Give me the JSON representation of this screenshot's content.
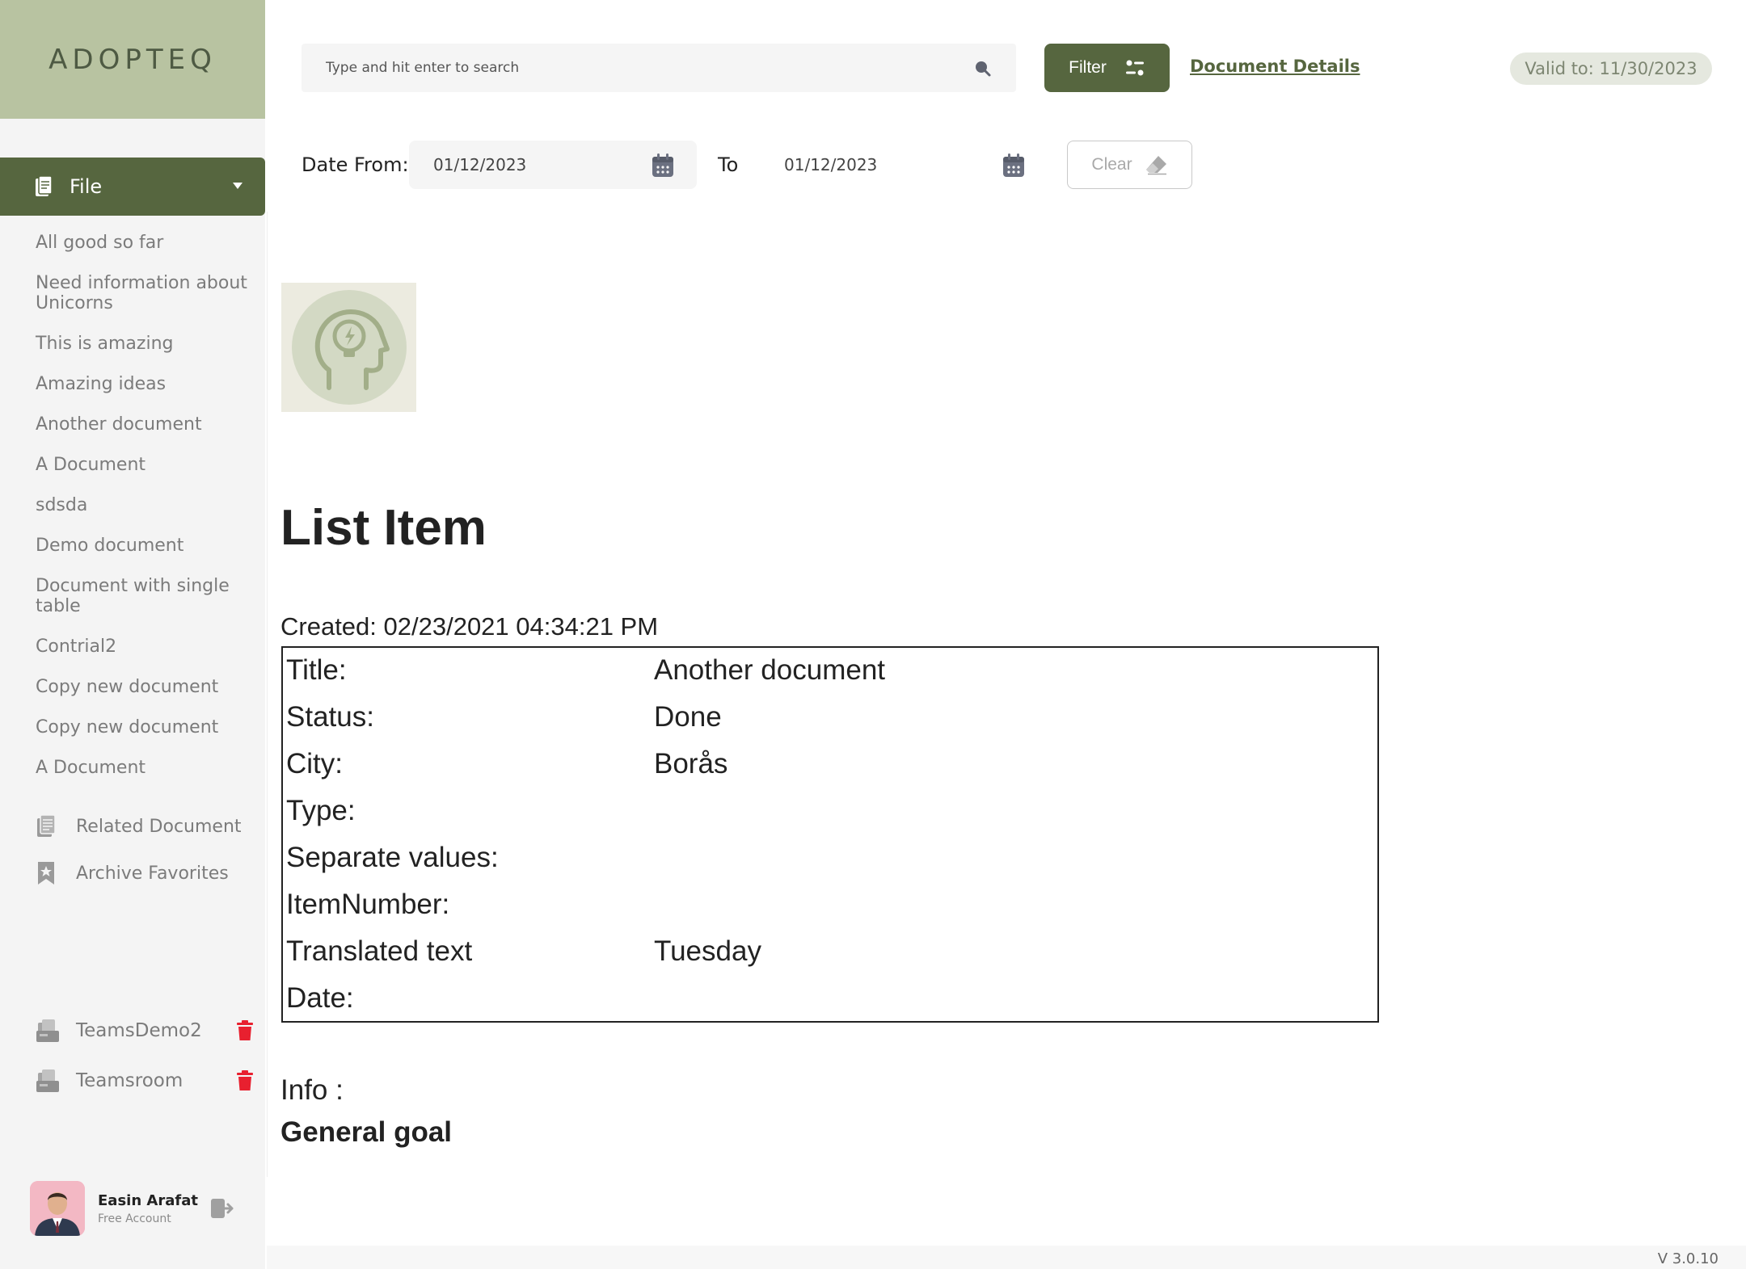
{
  "brand": {
    "logo_text": "ADOPTEQ"
  },
  "sidebar": {
    "file_tab_label": "File",
    "documents": [
      "All good so far",
      "Need information about Unicorns",
      "This is amazing",
      "Amazing ideas",
      "Another document",
      "A Document",
      "sdsda",
      "Demo document",
      "Document with single table",
      "Contrial2",
      "Copy new document",
      "Copy new document",
      "A Document"
    ],
    "related_document": "Related Document",
    "archive_favorites": "Archive Favorites",
    "teams": [
      "TeamsDemo2",
      "Teamsroom"
    ]
  },
  "user": {
    "name": "Easin Arafat",
    "plan": "Free Account"
  },
  "topbar": {
    "search_placeholder": "Type and hit enter to search",
    "filter_label": "Filter",
    "document_details_link": "Document Details",
    "valid_to": "Valid to: 11/30/2023"
  },
  "date_filter": {
    "from_label": "Date From:",
    "from_value": "01/12/2023",
    "to_label": "To",
    "to_value": "01/12/2023",
    "clear_label": "Clear"
  },
  "document": {
    "title": "List Item",
    "created": "Created: 02/23/2021 04:34:21 PM",
    "properties": [
      {
        "key": "Title:",
        "value": "Another document"
      },
      {
        "key": "Status:",
        "value": "Done"
      },
      {
        "key": "City:",
        "value": "Borås"
      },
      {
        "key": "Type:",
        "value": ""
      },
      {
        "key": "Separate values:",
        "value": ""
      },
      {
        "key": "ItemNumber:",
        "value": ""
      },
      {
        "key": "Translated text",
        "value": "Tuesday"
      },
      {
        "key": "Date:",
        "value": ""
      }
    ],
    "info_label": "Info :",
    "info_value": "General goal"
  },
  "footer": {
    "version": "V 3.0.10"
  },
  "colors": {
    "brand_green": "#56663f",
    "logo_bg": "#b8c3a1",
    "trash_red": "#e8202f",
    "badge_bg": "#e5e8df"
  },
  "icons": {
    "file_tab": "document-icon",
    "related": "document-stack-icon",
    "archive": "bookmark-star-icon",
    "team": "team-folder-icon",
    "delete": "trash-icon",
    "search": "search-icon",
    "filter": "sliders-icon",
    "calendar": "calendar-icon",
    "clear": "eraser-icon",
    "logout": "logout-icon",
    "content_image": "brain-idea-icon"
  }
}
